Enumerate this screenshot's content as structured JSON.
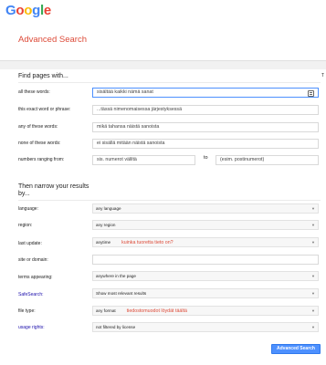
{
  "logo": {
    "letters": [
      "G",
      "o",
      "o",
      "g",
      "l",
      "e"
    ],
    "colors": [
      "#4285f4",
      "#ea4335",
      "#fbbc05",
      "#4285f4",
      "#34a853",
      "#ea4335"
    ]
  },
  "page_title": "Advanced Search",
  "find_section": {
    "title": "Find pages with...",
    "rows": [
      {
        "label": "all these words:",
        "value": "sisältää kaikki nämä sanat"
      },
      {
        "label": "this exact word or phrase:",
        "value": "...tässä nimenomaisessa järjestyksessä"
      },
      {
        "label": "any of these words:",
        "value": "mikä tahansa näistä sanoista"
      },
      {
        "label": "none of these words:",
        "value": "ei sisällä mitään näistä sanoista"
      }
    ],
    "range": {
      "label": "numbers ranging from:",
      "from_value": "sis. numerot väliltä",
      "to_label": "to",
      "to_value": "(esim. postinumerot)"
    }
  },
  "narrow_section": {
    "title": "Then narrow your results",
    "title_line2": "by...",
    "language": {
      "label": "language:",
      "value": "any language"
    },
    "region": {
      "label": "region:",
      "value": "any region"
    },
    "last_update": {
      "label": "last update:",
      "value": "anytime",
      "note": "kuinka tuoretta tieto on?"
    },
    "site": {
      "label": "site or domain:",
      "value": ""
    },
    "terms": {
      "label": "terms appearing:",
      "value": "anywhere in the page"
    },
    "safesearch": {
      "label": "SafeSearch:",
      "value": "Show most relevant results"
    },
    "file_type": {
      "label": "file type:",
      "value": "any format",
      "note": "tiedostomuodot löydät täältä"
    },
    "usage_rights": {
      "label": "usage rights:",
      "value": "not filtered by license"
    }
  },
  "search_button": "Advanced Search",
  "help_marker": "T",
  "colors": {
    "accent_red": "#dd4b39",
    "button_blue": "#4d90fe",
    "link_blue": "#1a0dab"
  },
  "icons": {
    "keyboard": "keyboard-icon",
    "dropdown": "chevron-down-icon"
  }
}
